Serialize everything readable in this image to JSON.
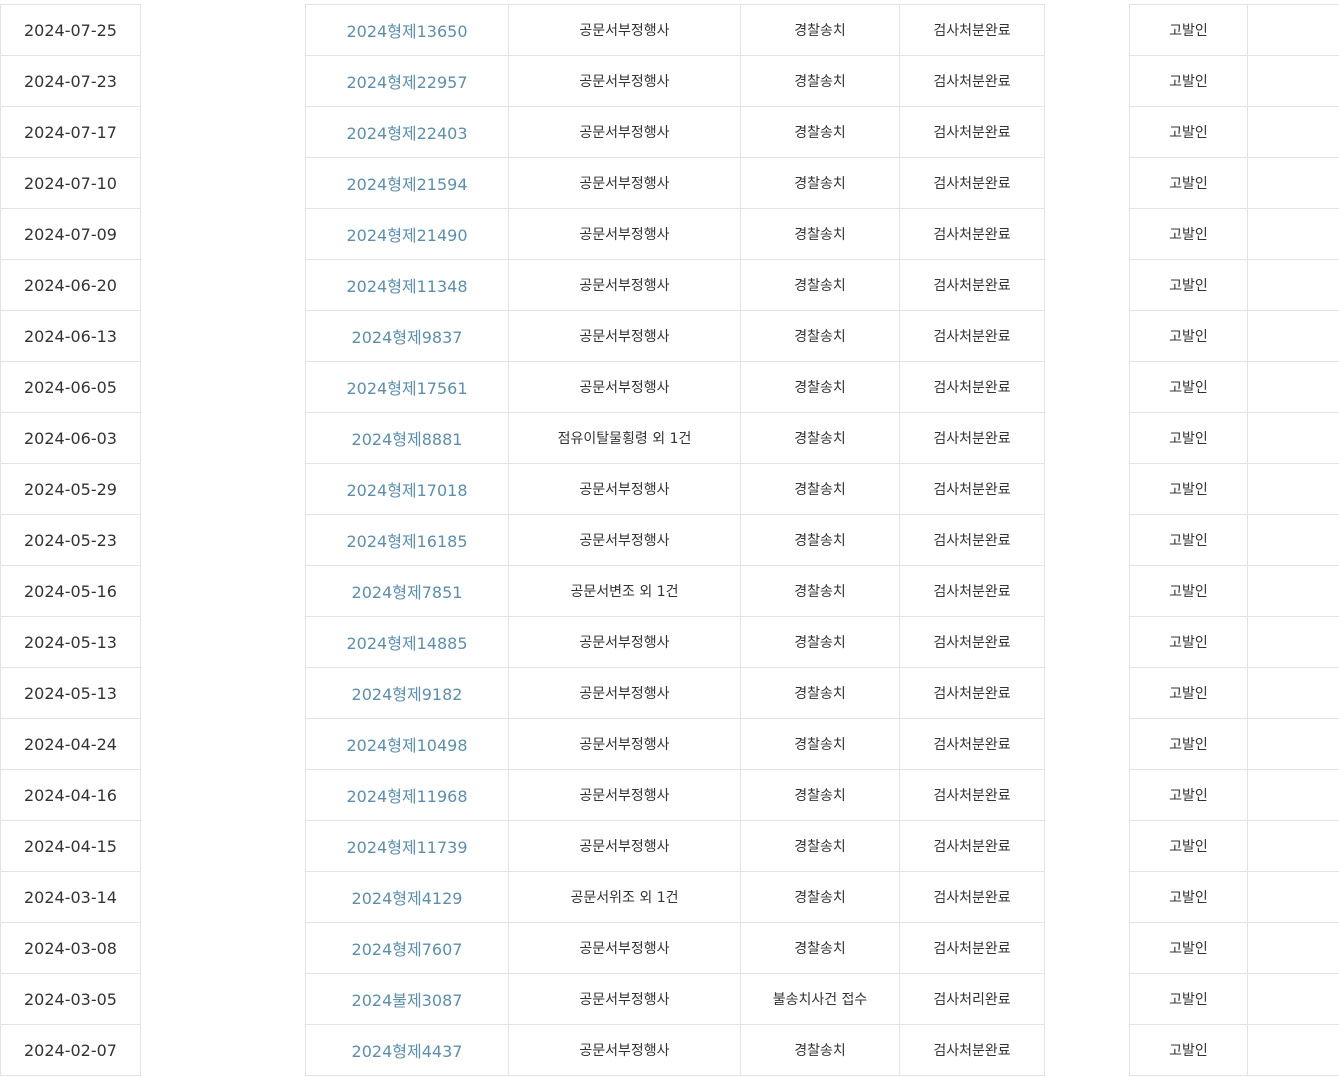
{
  "rows": [
    {
      "date": "2024-07-25",
      "case_no": "2024형제13650",
      "charge": "공문서부정행사",
      "status": "경찰송치",
      "result": "검사처분완료",
      "role": "고발인"
    },
    {
      "date": "2024-07-23",
      "case_no": "2024형제22957",
      "charge": "공문서부정행사",
      "status": "경찰송치",
      "result": "검사처분완료",
      "role": "고발인"
    },
    {
      "date": "2024-07-17",
      "case_no": "2024형제22403",
      "charge": "공문서부정행사",
      "status": "경찰송치",
      "result": "검사처분완료",
      "role": "고발인"
    },
    {
      "date": "2024-07-10",
      "case_no": "2024형제21594",
      "charge": "공문서부정행사",
      "status": "경찰송치",
      "result": "검사처분완료",
      "role": "고발인"
    },
    {
      "date": "2024-07-09",
      "case_no": "2024형제21490",
      "charge": "공문서부정행사",
      "status": "경찰송치",
      "result": "검사처분완료",
      "role": "고발인"
    },
    {
      "date": "2024-06-20",
      "case_no": "2024형제11348",
      "charge": "공문서부정행사",
      "status": "경찰송치",
      "result": "검사처분완료",
      "role": "고발인"
    },
    {
      "date": "2024-06-13",
      "case_no": "2024형제9837",
      "charge": "공문서부정행사",
      "status": "경찰송치",
      "result": "검사처분완료",
      "role": "고발인"
    },
    {
      "date": "2024-06-05",
      "case_no": "2024형제17561",
      "charge": "공문서부정행사",
      "status": "경찰송치",
      "result": "검사처분완료",
      "role": "고발인"
    },
    {
      "date": "2024-06-03",
      "case_no": "2024형제8881",
      "charge": "점유이탈물횡령 외 1건",
      "status": "경찰송치",
      "result": "검사처분완료",
      "role": "고발인"
    },
    {
      "date": "2024-05-29",
      "case_no": "2024형제17018",
      "charge": "공문서부정행사",
      "status": "경찰송치",
      "result": "검사처분완료",
      "role": "고발인"
    },
    {
      "date": "2024-05-23",
      "case_no": "2024형제16185",
      "charge": "공문서부정행사",
      "status": "경찰송치",
      "result": "검사처분완료",
      "role": "고발인"
    },
    {
      "date": "2024-05-16",
      "case_no": "2024형제7851",
      "charge": "공문서변조 외 1건",
      "status": "경찰송치",
      "result": "검사처분완료",
      "role": "고발인"
    },
    {
      "date": "2024-05-13",
      "case_no": "2024형제14885",
      "charge": "공문서부정행사",
      "status": "경찰송치",
      "result": "검사처분완료",
      "role": "고발인"
    },
    {
      "date": "2024-05-13",
      "case_no": "2024형제9182",
      "charge": "공문서부정행사",
      "status": "경찰송치",
      "result": "검사처분완료",
      "role": "고발인"
    },
    {
      "date": "2024-04-24",
      "case_no": "2024형제10498",
      "charge": "공문서부정행사",
      "status": "경찰송치",
      "result": "검사처분완료",
      "role": "고발인"
    },
    {
      "date": "2024-04-16",
      "case_no": "2024형제11968",
      "charge": "공문서부정행사",
      "status": "경찰송치",
      "result": "검사처분완료",
      "role": "고발인"
    },
    {
      "date": "2024-04-15",
      "case_no": "2024형제11739",
      "charge": "공문서부정행사",
      "status": "경찰송치",
      "result": "검사처분완료",
      "role": "고발인"
    },
    {
      "date": "2024-03-14",
      "case_no": "2024형제4129",
      "charge": "공문서위조 외 1건",
      "status": "경찰송치",
      "result": "검사처분완료",
      "role": "고발인"
    },
    {
      "date": "2024-03-08",
      "case_no": "2024형제7607",
      "charge": "공문서부정행사",
      "status": "경찰송치",
      "result": "검사처분완료",
      "role": "고발인"
    },
    {
      "date": "2024-03-05",
      "case_no": "2024불제3087",
      "charge": "공문서부정행사",
      "status": "불송치사건 접수",
      "result": "검사처리완료",
      "role": "고발인"
    },
    {
      "date": "2024-02-07",
      "case_no": "2024형제4437",
      "charge": "공문서부정행사",
      "status": "경찰송치",
      "result": "검사처분완료",
      "role": "고발인"
    }
  ],
  "colors": {
    "link": "#5b8fb0",
    "text": "#333333",
    "border": "#e3e3e3"
  }
}
